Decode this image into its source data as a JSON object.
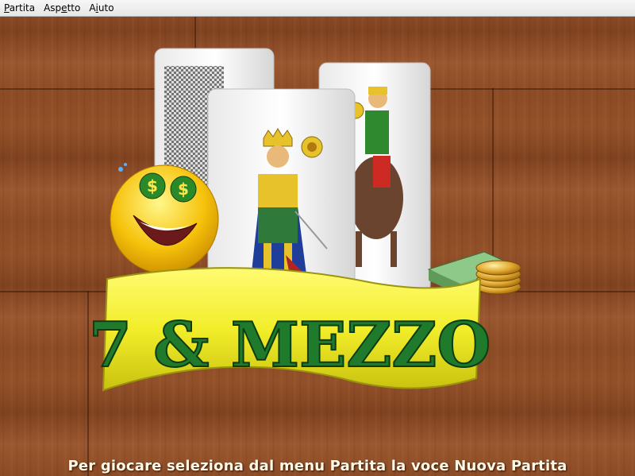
{
  "menu": {
    "items": [
      {
        "label_pre": "",
        "mnemonic": "P",
        "label_post": "artita"
      },
      {
        "label_pre": "Asp",
        "mnemonic": "e",
        "label_post": "tto"
      },
      {
        "label_pre": "A",
        "mnemonic": "i",
        "label_post": "uto"
      }
    ]
  },
  "logo": {
    "title": "7 & MEZZO",
    "smiley_eye_symbol": "$"
  },
  "status": {
    "message": "Per giocare seleziona dal menu Partita la voce Nuova Partita"
  },
  "colors": {
    "wood": "#8b4b24",
    "banner_yellow": "#f2ee2a",
    "title_green": "#1f7a2c",
    "status_text": "#fff8e6"
  }
}
